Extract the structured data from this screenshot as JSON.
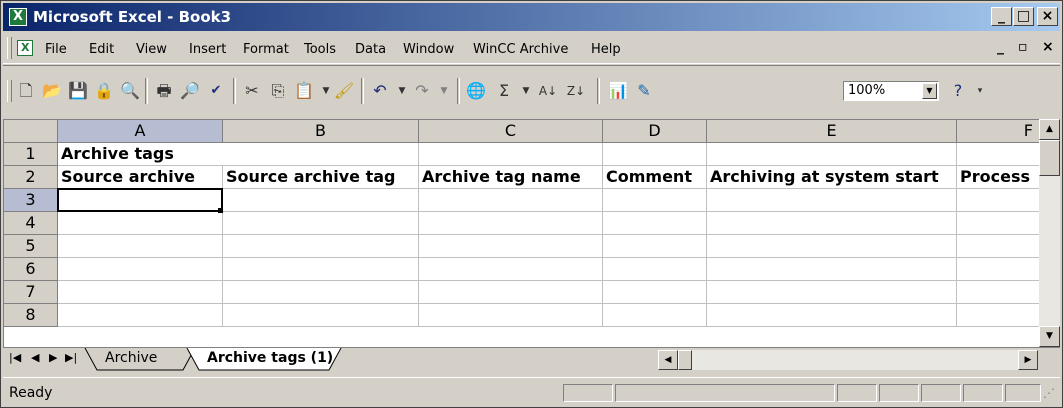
{
  "window": {
    "title": "Microsoft Excel - Book3"
  },
  "caption_buttons": {
    "minimize": "_",
    "restore": "□",
    "close": "×"
  },
  "menubar": {
    "items": [
      {
        "label": "File"
      },
      {
        "label": "Edit"
      },
      {
        "label": "View"
      },
      {
        "label": "Insert"
      },
      {
        "label": "Format"
      },
      {
        "label": "Tools"
      },
      {
        "label": "Data"
      },
      {
        "label": "Window"
      },
      {
        "label": "WinCC Archive"
      },
      {
        "label": "Help"
      }
    ],
    "doc_controls": {
      "minimize": "_",
      "restore": "▫",
      "close": "×"
    }
  },
  "toolbar": {
    "icons": [
      "new-icon",
      "open-icon",
      "save-icon",
      "permission-icon",
      "research-icon",
      "print-icon",
      "print-preview-icon",
      "spelling-icon",
      "cut-icon",
      "copy-icon",
      "paste-icon",
      "format-painter-icon",
      "undo-icon",
      "redo-icon",
      "hyperlink-icon",
      "autosum-icon",
      "sort-ascending-icon",
      "sort-descending-icon",
      "chart-wizard-icon",
      "drawing-icon",
      "help-icon"
    ],
    "zoom": "100%"
  },
  "sheet": {
    "columns": [
      "A",
      "B",
      "C",
      "D",
      "E",
      "F"
    ],
    "rows": [
      "1",
      "2",
      "3",
      "4",
      "5",
      "6",
      "7",
      "8"
    ],
    "cells": {
      "r1": {
        "A": "Archive tags"
      },
      "r2": {
        "A": "Source archive",
        "B": "Source archive tag",
        "C": "Archive tag name",
        "D": "Comment",
        "E": "Archiving at system start",
        "F": "Process"
      }
    },
    "active_cell": "A3"
  },
  "tabs": {
    "sheets": [
      {
        "label": "Archive"
      },
      {
        "label": "Archive tags (1)",
        "active": true
      }
    ]
  },
  "status": {
    "text": "Ready"
  }
}
